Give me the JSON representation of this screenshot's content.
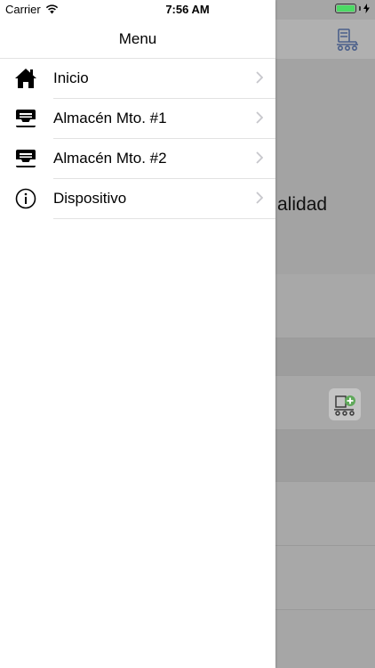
{
  "status_bar": {
    "carrier": "Carrier",
    "time": "7:56 AM",
    "battery_level": 1.0,
    "battery_color": "#4cd964"
  },
  "drawer": {
    "title": "Menu",
    "items": [
      {
        "label": "Inicio",
        "icon": "home-icon"
      },
      {
        "label": "Almacén Mto. #1",
        "icon": "inbox-tray-icon"
      },
      {
        "label": "Almacén Mto. #2",
        "icon": "inbox-tray-icon"
      },
      {
        "label": "Dispositivo",
        "icon": "info-icon"
      }
    ]
  },
  "background": {
    "hero_text_fragment": "alidad",
    "icons": [
      "cart-icon",
      "cart-add-icon"
    ]
  }
}
